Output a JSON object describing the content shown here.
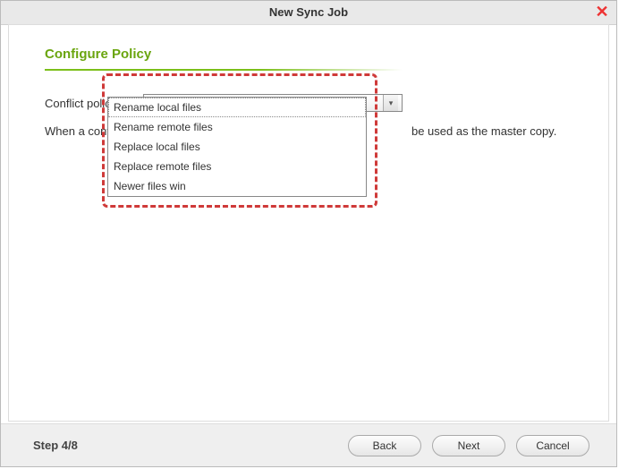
{
  "window": {
    "title": "New Sync Job"
  },
  "section": {
    "title": "Configure Policy"
  },
  "form": {
    "conflict_label": "Conflict policy:",
    "selected": "Rename local files",
    "desc_before": "When a conflict is d",
    "desc_after": "be used as the master copy."
  },
  "options": [
    "Rename local files",
    "Rename remote files",
    "Replace local files",
    "Replace remote files",
    "Newer files win"
  ],
  "footer": {
    "step": "Step 4/8",
    "back": "Back",
    "next": "Next",
    "cancel": "Cancel"
  }
}
